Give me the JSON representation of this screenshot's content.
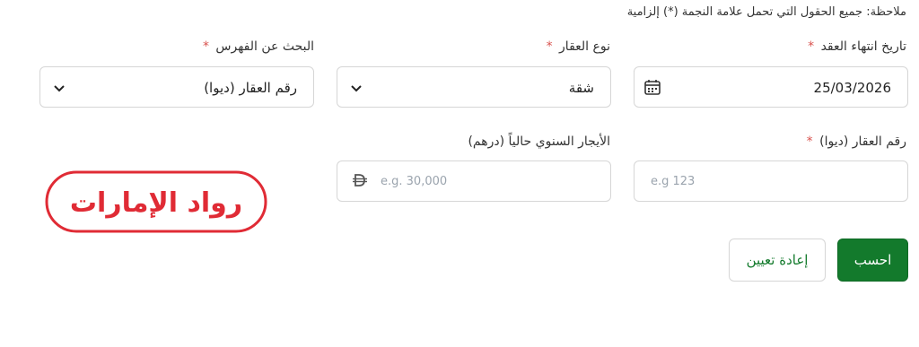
{
  "note": "ملاحظة: جميع الحقول التي تحمل علامة النجمة (*) إلزامية",
  "required_mark": "*",
  "fields": {
    "contract_end": {
      "label": "تاريخ انتهاء العقد",
      "value": "25/03/2026",
      "icon": "calendar-icon"
    },
    "property_type": {
      "label": "نوع العقار",
      "value": "شقة",
      "icon": "chevron-down-icon"
    },
    "index_search": {
      "label": "البحث عن الفهرس",
      "value": "رقم العقار (ديوا)",
      "icon": "chevron-down-icon"
    },
    "dewa_number": {
      "label": "رقم العقار (ديوا)",
      "placeholder": "e.g 123"
    },
    "annual_rent": {
      "label": "الأيجار السنوي حالياً (درهم)",
      "placeholder": "e.g. 30,000",
      "icon": "dirham-icon"
    }
  },
  "buttons": {
    "calculate": "احسب",
    "reset": "إعادة تعيين"
  },
  "logo": {
    "text": "رواد الإمارات",
    "color": "#e02b35"
  },
  "colors": {
    "primary": "#137a2c",
    "required": "#d9534f"
  }
}
